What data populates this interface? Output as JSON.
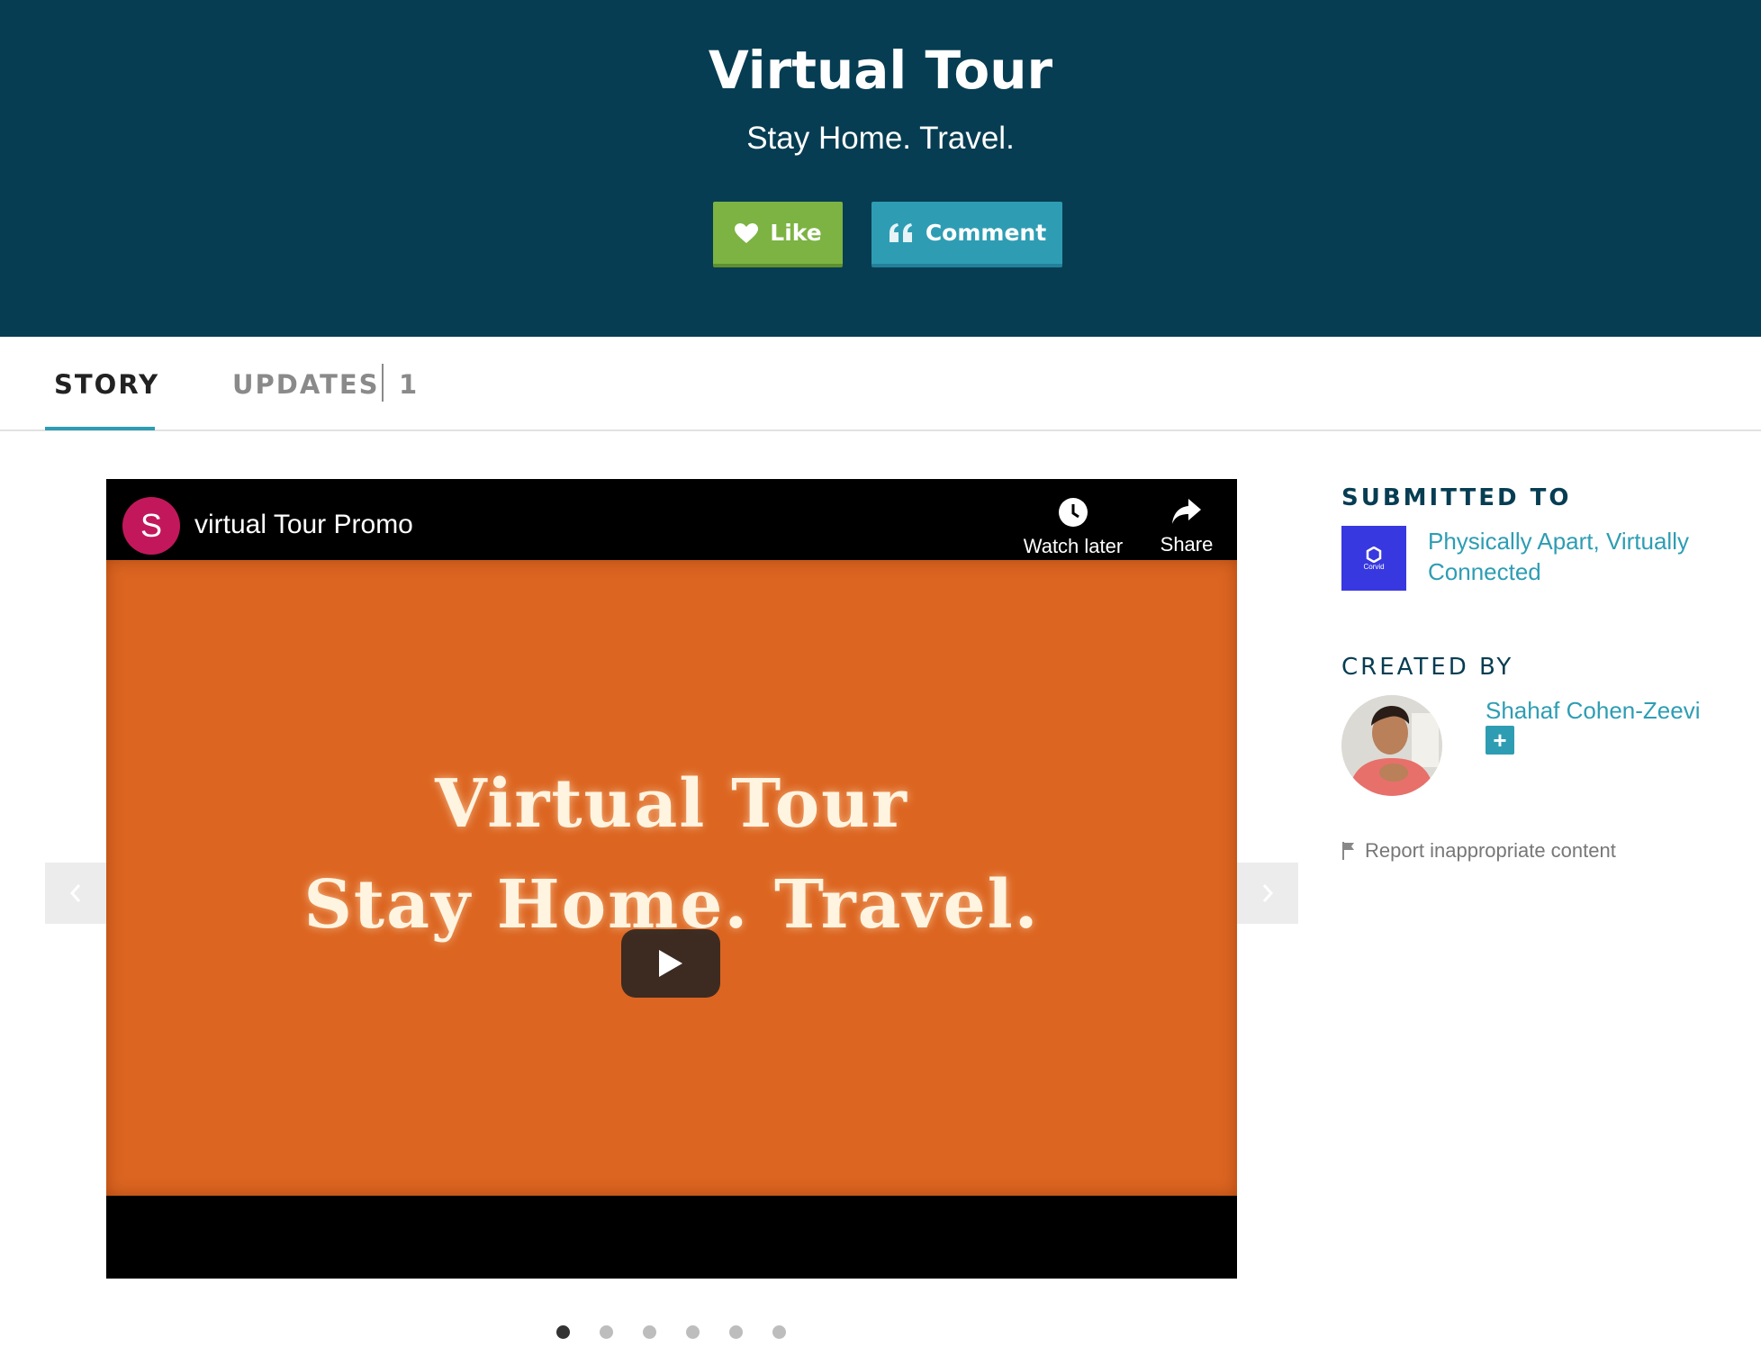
{
  "hero": {
    "title": "Virtual Tour",
    "subtitle": "Stay Home. Travel.",
    "like_label": "Like",
    "comment_label": "Comment"
  },
  "tabs": {
    "story": "STORY",
    "updates": "UPDATES",
    "updates_count": "1"
  },
  "video": {
    "channel_initial": "S",
    "title": "virtual Tour Promo",
    "watch_later": "Watch later",
    "share": "Share",
    "frame_line1": "Virtual Tour",
    "frame_line2": "Stay Home. Travel."
  },
  "carousel": {
    "slide_count": 6,
    "active_index": 0
  },
  "sidebar": {
    "submitted_heading": "SUBMITTED TO",
    "contest_name": "Physically Apart, Virtually Connected",
    "contest_thumb_text": "Corvid",
    "created_heading": "CREATED BY",
    "creator_name": "Shahaf Cohen-Zeevi",
    "follow_symbol": "+",
    "report": "Report inappropriate content"
  },
  "colors": {
    "hero_bg": "#063d52",
    "like_green": "#7cb342",
    "accent_teal": "#2e9db3",
    "video_orange": "#dc6521"
  }
}
